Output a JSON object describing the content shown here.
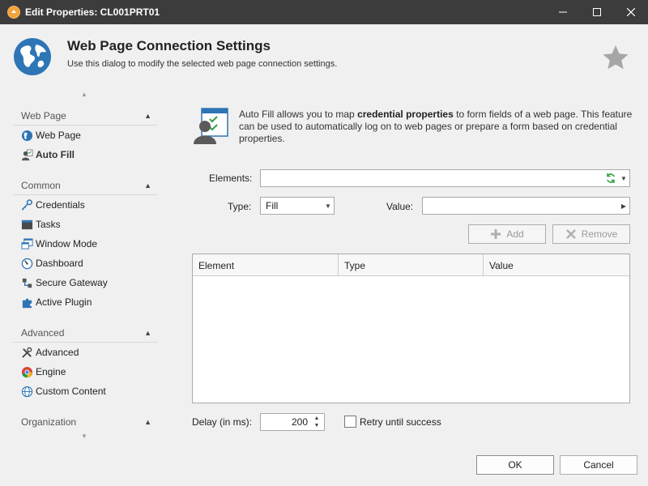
{
  "window": {
    "title": "Edit Properties: CL001PRT01",
    "minimize_icon": "minimize-icon",
    "maximize_icon": "maximize-icon",
    "close_icon": "close-icon"
  },
  "header": {
    "title": "Web Page Connection Settings",
    "subtitle": "Use this dialog to modify the selected web page connection settings."
  },
  "nav": {
    "groups": [
      {
        "label": "Web Page",
        "items": [
          {
            "label": "Web Page",
            "icon": "globe-icon"
          },
          {
            "label": "Auto Fill",
            "icon": "autofill-icon",
            "active": true
          }
        ]
      },
      {
        "label": "Common",
        "items": [
          {
            "label": "Credentials",
            "icon": "key-icon"
          },
          {
            "label": "Tasks",
            "icon": "tasks-icon"
          },
          {
            "label": "Window Mode",
            "icon": "window-icon"
          },
          {
            "label": "Dashboard",
            "icon": "dashboard-icon"
          },
          {
            "label": "Secure Gateway",
            "icon": "gateway-icon"
          },
          {
            "label": "Active Plugin",
            "icon": "plugin-icon"
          }
        ]
      },
      {
        "label": "Advanced",
        "items": [
          {
            "label": "Advanced",
            "icon": "tools-icon"
          },
          {
            "label": "Engine",
            "icon": "chrome-icon"
          },
          {
            "label": "Custom Content",
            "icon": "web-content-icon"
          }
        ]
      },
      {
        "label": "Organization",
        "items": []
      }
    ]
  },
  "content": {
    "description_prefix": "Auto Fill allows you to map ",
    "description_bold": "credential properties",
    "description_suffix": " to form fields of a web page. This feature can be used to automatically log on to web pages or prepare a form based on credential properties.",
    "elements_label": "Elements:",
    "elements_value": "",
    "type_label": "Type:",
    "type_value": "Fill",
    "value_label": "Value:",
    "value_value": "",
    "add_label": "Add",
    "remove_label": "Remove",
    "columns": [
      "Element",
      "Type",
      "Value"
    ],
    "delay_label": "Delay (in ms):",
    "delay_value": "200",
    "retry_label": "Retry until success"
  },
  "footer": {
    "ok_label": "OK",
    "cancel_label": "Cancel"
  },
  "colors": {
    "titlebar": "#3c3c3c",
    "accent_blue": "#2e75b6",
    "refresh_green": "#2f9e44"
  }
}
